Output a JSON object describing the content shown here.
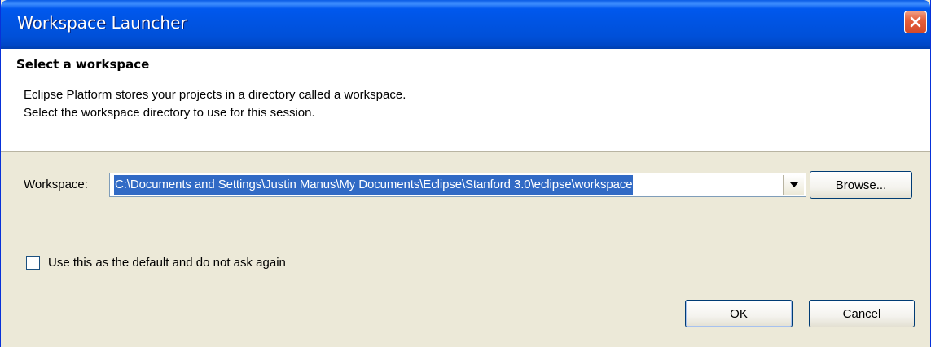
{
  "window": {
    "title": "Workspace Launcher"
  },
  "header": {
    "title": "Select a workspace",
    "description_line1": "Eclipse Platform stores your projects in a directory called a workspace.",
    "description_line2": "Select the workspace directory to use for this session."
  },
  "workspace": {
    "label": "Workspace:",
    "value": "C:\\Documents and Settings\\Justin Manus\\My Documents\\Eclipse\\Stanford 3.0\\eclipse\\workspace",
    "browse_label": "Browse..."
  },
  "default_option": {
    "label": "Use this as the default and do not ask again",
    "checked": false
  },
  "buttons": {
    "ok_label": "OK",
    "cancel_label": "Cancel"
  },
  "icons": {
    "close": "close-icon",
    "dropdown": "chevron-down-icon"
  },
  "colors": {
    "title_bar": "#0054e3",
    "close_button": "#e5603c",
    "selection": "#316ac5",
    "dialog_background": "#ece9d8"
  }
}
